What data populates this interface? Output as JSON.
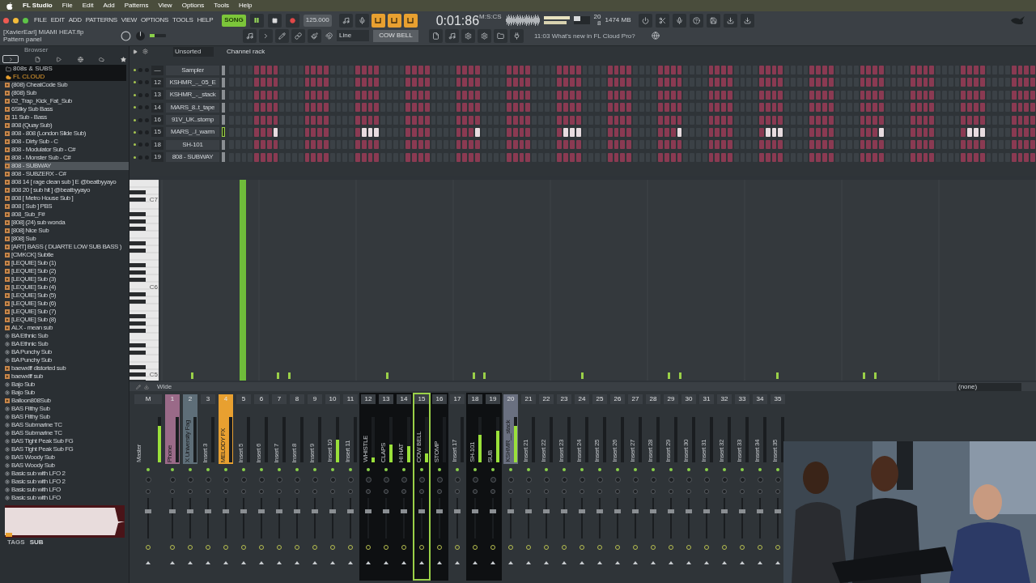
{
  "menubar": {
    "app": "FL Studio",
    "items": [
      "File",
      "Edit",
      "Add",
      "Patterns",
      "View",
      "Options",
      "Tools",
      "Help"
    ]
  },
  "toolbar": {
    "pitch": {
      "level": 0.3
    },
    "menu": [
      "FILE",
      "EDIT",
      "ADD",
      "PATTERNS",
      "VIEW",
      "OPTIONS",
      "TOOLS",
      "HELP"
    ],
    "song_mode": {
      "label": "SONG",
      "on": true
    },
    "tempo": "125.000",
    "toggles": [
      {
        "on": true
      },
      {
        "on": true
      },
      {
        "on": true
      }
    ],
    "time": "0:01:86",
    "time_unit": "M:S:CS",
    "cpu": "20",
    "memory": "1474 MB",
    "polyphony": "8",
    "project": "[XavierEarl] MIAMI HEAT.flp",
    "hint": "Pattern panel",
    "snap": "Line",
    "pattern": "COW BELL",
    "news": "11:03 What's new in FL Cloud Pro?"
  },
  "browser": {
    "title": "Browser",
    "folder": "808s & SUBS",
    "cloud": "FL CLOUD",
    "items": [
      {
        "name": "(808) CheatCode Sub",
        "kind": "audio",
        "selected": false
      },
      {
        "name": "(808) Sub",
        "kind": "audio",
        "selected": false
      },
      {
        "name": "02_Trap_Kick_Fat_Sub",
        "kind": "audio",
        "selected": false
      },
      {
        "name": "6Silky Sub Bass",
        "kind": "audio",
        "selected": false
      },
      {
        "name": "11 Sub - Bass",
        "kind": "audio",
        "selected": false
      },
      {
        "name": "808 (Quay Sub)",
        "kind": "audio",
        "selected": false
      },
      {
        "name": "808 - 808 (London Slide Sub)",
        "kind": "audio",
        "selected": false
      },
      {
        "name": "808 - Dirty Sub - C",
        "kind": "audio",
        "selected": false
      },
      {
        "name": "808 - Modulator Sub - C#",
        "kind": "audio",
        "selected": false
      },
      {
        "name": "808 - Monster Sub - C#",
        "kind": "audio",
        "selected": false
      },
      {
        "name": "808 - SUBWAY",
        "kind": "audio",
        "selected": true
      },
      {
        "name": "808 - SUBZERX - C#",
        "kind": "audio",
        "selected": false
      },
      {
        "name": "808 14 [ rage clean sub ] E @beatbyyayo",
        "kind": "audio",
        "selected": false
      },
      {
        "name": "808 20 [ sub hit ] @beatbyyayo",
        "kind": "audio",
        "selected": false
      },
      {
        "name": "808 [ Metro House Sub ]",
        "kind": "audio",
        "selected": false
      },
      {
        "name": "808 [ Sub ] PBS",
        "kind": "audio",
        "selected": false
      },
      {
        "name": "808_Sub_F#",
        "kind": "audio",
        "selected": false
      },
      {
        "name": "[808] (24) sub wonda",
        "kind": "audio",
        "selected": false
      },
      {
        "name": "[808] Nice Sub",
        "kind": "audio",
        "selected": false
      },
      {
        "name": "[808] Sub",
        "kind": "audio",
        "selected": false
      },
      {
        "name": "[ART] BASS ( DUARTE LOW SUB BASS )",
        "kind": "audio",
        "selected": false
      },
      {
        "name": "[CMKCK] Subtle",
        "kind": "audio",
        "selected": false
      },
      {
        "name": "[LEQUIE] Sub (1)",
        "kind": "audio",
        "selected": false
      },
      {
        "name": "[LEQUIE] Sub (2)",
        "kind": "audio",
        "selected": false
      },
      {
        "name": "[LEQUIE] Sub (3)",
        "kind": "audio",
        "selected": false
      },
      {
        "name": "[LEQUIE] Sub (4)",
        "kind": "audio",
        "selected": false
      },
      {
        "name": "[LEQUIE] Sub (5)",
        "kind": "audio",
        "selected": false
      },
      {
        "name": "[LEQUIE] Sub (6)",
        "kind": "audio",
        "selected": false
      },
      {
        "name": "[LEQUIE] Sub (7)",
        "kind": "audio",
        "selected": false
      },
      {
        "name": "[LEQUIE] Sub (8)",
        "kind": "audio",
        "selected": false
      },
      {
        "name": "ALX - mean sub",
        "kind": "audio",
        "selected": false
      },
      {
        "name": "BA Ethnic Sub",
        "kind": "preset",
        "selected": false
      },
      {
        "name": "BA Ethnic Sub",
        "kind": "preset",
        "selected": false
      },
      {
        "name": "BA Punchy Sub",
        "kind": "preset",
        "selected": false
      },
      {
        "name": "BA Punchy Sub",
        "kind": "preset",
        "selected": false
      },
      {
        "name": "baewxlff distorted sub",
        "kind": "audio",
        "selected": false
      },
      {
        "name": "baewxlff sub",
        "kind": "audio",
        "selected": false
      },
      {
        "name": "Bajo Sub",
        "kind": "preset",
        "selected": false
      },
      {
        "name": "Bajo Sub",
        "kind": "preset",
        "selected": false
      },
      {
        "name": "Balloon808Sub",
        "kind": "audio",
        "selected": false
      },
      {
        "name": "BAS Filthy Sub",
        "kind": "preset",
        "selected": false
      },
      {
        "name": "BAS Filthy Sub",
        "kind": "preset",
        "selected": false
      },
      {
        "name": "BAS Submarine TC",
        "kind": "preset",
        "selected": false
      },
      {
        "name": "BAS Submarine TC",
        "kind": "preset",
        "selected": false
      },
      {
        "name": "BAS Tight Peak Sub FG",
        "kind": "preset",
        "selected": false
      },
      {
        "name": "BAS Tight Peak Sub FG",
        "kind": "preset",
        "selected": false
      },
      {
        "name": "BAS Woody Sub",
        "kind": "preset",
        "selected": false
      },
      {
        "name": "BAS Woody Sub",
        "kind": "preset",
        "selected": false
      },
      {
        "name": "Basic sub with LFO 2",
        "kind": "preset",
        "selected": false
      },
      {
        "name": "Basic sub with LFO 2",
        "kind": "preset",
        "selected": false
      },
      {
        "name": "Basic sub with LFO",
        "kind": "preset",
        "selected": false
      },
      {
        "name": "Basic sub with LFO",
        "kind": "preset",
        "selected": false
      }
    ],
    "tags_label": "TAGS",
    "tag": "SUB"
  },
  "channel_rack": {
    "filter": "Unsorted",
    "title": "Channel rack",
    "channels": [
      {
        "number": "—",
        "name": "Sampler",
        "selected": false,
        "steps": [
          false,
          false,
          false,
          false,
          true,
          true,
          true,
          true,
          false,
          false,
          false,
          false,
          true,
          true,
          true,
          true,
          false,
          false,
          false,
          false,
          true,
          true,
          true,
          true,
          false,
          false,
          false,
          false,
          true,
          true,
          true,
          true
        ],
        "lit": [
          false,
          false,
          false,
          false,
          false,
          false,
          false,
          false,
          false,
          false,
          false,
          false,
          false,
          false,
          false,
          false,
          false,
          false,
          false,
          false,
          false,
          false,
          false,
          false,
          false,
          false,
          false,
          false,
          false,
          false,
          false,
          false
        ]
      },
      {
        "number": "12",
        "name": "KSHMR_.._05_E",
        "selected": false,
        "steps": [
          false,
          false,
          false,
          false,
          true,
          true,
          true,
          true,
          false,
          false,
          false,
          false,
          true,
          true,
          true,
          true,
          false,
          false,
          false,
          false,
          true,
          true,
          true,
          true,
          false,
          false,
          false,
          false,
          true,
          true,
          true,
          true
        ],
        "lit": [
          false,
          false,
          false,
          false,
          false,
          false,
          false,
          false,
          false,
          false,
          false,
          false,
          false,
          false,
          false,
          false,
          false,
          false,
          false,
          false,
          false,
          false,
          false,
          false,
          false,
          false,
          false,
          false,
          false,
          false,
          false,
          false
        ]
      },
      {
        "number": "13",
        "name": "KSHMR_.._stack",
        "selected": false,
        "steps": [
          false,
          false,
          false,
          false,
          true,
          true,
          true,
          true,
          false,
          false,
          false,
          false,
          true,
          true,
          true,
          true,
          false,
          false,
          false,
          false,
          true,
          true,
          true,
          true,
          false,
          false,
          false,
          false,
          true,
          true,
          true,
          true
        ],
        "lit": [
          false,
          false,
          false,
          false,
          false,
          false,
          false,
          false,
          false,
          false,
          false,
          false,
          false,
          false,
          false,
          false,
          false,
          false,
          false,
          false,
          false,
          false,
          false,
          false,
          false,
          false,
          false,
          false,
          false,
          false,
          false,
          false
        ]
      },
      {
        "number": "14",
        "name": "MARS_8..t_tape",
        "selected": false,
        "steps": [
          false,
          false,
          false,
          false,
          true,
          true,
          true,
          true,
          false,
          false,
          false,
          false,
          true,
          true,
          true,
          true,
          false,
          false,
          false,
          false,
          true,
          true,
          true,
          true,
          false,
          false,
          false,
          false,
          true,
          true,
          true,
          true
        ],
        "lit": [
          false,
          false,
          false,
          false,
          false,
          false,
          false,
          false,
          false,
          false,
          false,
          false,
          false,
          false,
          false,
          false,
          false,
          false,
          false,
          false,
          false,
          false,
          false,
          false,
          false,
          false,
          false,
          false,
          false,
          false,
          false,
          false
        ]
      },
      {
        "number": "16",
        "name": "91V_UK..stomp",
        "selected": false,
        "steps": [
          false,
          false,
          false,
          false,
          true,
          true,
          true,
          true,
          false,
          false,
          false,
          false,
          true,
          true,
          true,
          true,
          false,
          false,
          false,
          false,
          true,
          true,
          true,
          true,
          false,
          false,
          false,
          false,
          true,
          true,
          true,
          true
        ],
        "lit": [
          false,
          false,
          false,
          false,
          false,
          false,
          false,
          false,
          false,
          false,
          false,
          false,
          false,
          false,
          false,
          false,
          false,
          false,
          false,
          false,
          false,
          false,
          false,
          false,
          false,
          false,
          false,
          false,
          false,
          false,
          false,
          false
        ]
      },
      {
        "number": "15",
        "name": "MARS_..l_warm",
        "selected": true,
        "steps": [
          false,
          false,
          false,
          false,
          true,
          true,
          true,
          true,
          false,
          false,
          false,
          false,
          true,
          true,
          true,
          true,
          false,
          false,
          false,
          false,
          true,
          true,
          true,
          true,
          false,
          false,
          false,
          false,
          true,
          true,
          true,
          true
        ],
        "lit": [
          false,
          false,
          false,
          false,
          false,
          false,
          false,
          true,
          false,
          false,
          false,
          false,
          false,
          false,
          false,
          false,
          false,
          false,
          false,
          false,
          false,
          true,
          true,
          true,
          false,
          false,
          false,
          false,
          false,
          false,
          false,
          false
        ]
      },
      {
        "number": "18",
        "name": "SH-101",
        "selected": false,
        "steps": [
          false,
          false,
          false,
          false,
          true,
          true,
          true,
          true,
          false,
          false,
          false,
          false,
          true,
          true,
          true,
          true,
          false,
          false,
          false,
          false,
          true,
          true,
          true,
          true,
          false,
          false,
          false,
          false,
          true,
          true,
          true,
          true
        ],
        "lit": [
          false,
          false,
          false,
          false,
          false,
          false,
          false,
          false,
          false,
          false,
          false,
          false,
          false,
          false,
          false,
          false,
          false,
          false,
          false,
          false,
          false,
          false,
          false,
          false,
          false,
          false,
          false,
          false,
          false,
          false,
          false,
          false
        ]
      },
      {
        "number": "19",
        "name": "808 - SUBWAY",
        "selected": false,
        "steps": [
          false,
          false,
          false,
          false,
          true,
          true,
          true,
          true,
          false,
          false,
          false,
          false,
          true,
          true,
          true,
          true,
          false,
          false,
          false,
          false,
          true,
          true,
          true,
          true,
          false,
          false,
          false,
          false,
          true,
          true,
          true,
          true
        ],
        "lit": [
          false,
          false,
          false,
          false,
          false,
          false,
          false,
          false,
          false,
          false,
          false,
          false,
          false,
          false,
          false,
          false,
          false,
          false,
          false,
          false,
          false,
          false,
          false,
          false,
          false,
          false,
          false,
          false,
          false,
          false,
          false,
          false
        ]
      }
    ]
  },
  "piano_roll": {
    "key_labels": [
      "C7",
      "C6",
      "C5"
    ]
  },
  "mixer": {
    "mode": "Wide",
    "route": "(none)",
    "tracks": [
      {
        "number": "M",
        "name": "Master",
        "color": "#3a3f44",
        "level": 0.8,
        "highlighted": false,
        "selected": false
      },
      {
        "number": "1",
        "name": "Phone",
        "color": "#9a6a88",
        "level": 0,
        "highlighted": false,
        "selected": false
      },
      {
        "number": "2",
        "name": "X University Fag",
        "color": "#5e6e78",
        "level": 0,
        "highlighted": false,
        "selected": false
      },
      {
        "number": "3",
        "name": "Insert 3",
        "color": "#3a3f44",
        "level": 0,
        "highlighted": false,
        "selected": false
      },
      {
        "number": "4",
        "name": "MELODY FX",
        "color": "#e8a030",
        "level": 0,
        "highlighted": false,
        "selected": false
      },
      {
        "number": "5",
        "name": "Insert 5",
        "color": "#3a3f44",
        "level": 0,
        "highlighted": false,
        "selected": false
      },
      {
        "number": "6",
        "name": "Insert 6",
        "color": "#3a3f44",
        "level": 0,
        "highlighted": false,
        "selected": false
      },
      {
        "number": "7",
        "name": "Insert 7",
        "color": "#3a3f44",
        "level": 0,
        "highlighted": false,
        "selected": false
      },
      {
        "number": "8",
        "name": "Insert 8",
        "color": "#3a3f44",
        "level": 0,
        "highlighted": false,
        "selected": false
      },
      {
        "number": "9",
        "name": "Insert 9",
        "color": "#3a3f44",
        "level": 0,
        "highlighted": false,
        "selected": false
      },
      {
        "number": "10",
        "name": "Insert 10",
        "color": "#3a3f44",
        "level": 0.5,
        "highlighted": false,
        "selected": false
      },
      {
        "number": "11",
        "name": "Insert 11",
        "color": "#3a3f44",
        "level": 0,
        "highlighted": false,
        "selected": false
      },
      {
        "number": "12",
        "name": "WHISTLE",
        "color": "#3a3f44",
        "level": 0.1,
        "highlighted": true,
        "selected": false
      },
      {
        "number": "13",
        "name": "CLAPS",
        "color": "#3a3f44",
        "level": 0.4,
        "highlighted": true,
        "selected": false
      },
      {
        "number": "14",
        "name": "HI HAT",
        "color": "#3a3f44",
        "level": 0.35,
        "highlighted": true,
        "selected": false
      },
      {
        "number": "15",
        "name": "COW BELL",
        "color": "#3a3f44",
        "level": 0.2,
        "highlighted": true,
        "selected": true
      },
      {
        "number": "16",
        "name": "STOMP",
        "color": "#3a3f44",
        "level": 0,
        "highlighted": true,
        "selected": false
      },
      {
        "number": "17",
        "name": "Insert 17",
        "color": "#3a3f44",
        "level": 0,
        "highlighted": false,
        "selected": false
      },
      {
        "number": "18",
        "name": "SH-101",
        "color": "#3a3f44",
        "level": 0.6,
        "highlighted": true,
        "selected": false
      },
      {
        "number": "19",
        "name": "SUB",
        "color": "#3a3f44",
        "level": 0.7,
        "highlighted": true,
        "selected": false
      },
      {
        "number": "20",
        "name": "KSHMR__stack",
        "color": "#6a7080",
        "level": 0.8,
        "highlighted": false,
        "selected": false
      },
      {
        "number": "21",
        "name": "Insert 21",
        "color": "#3a3f44",
        "level": 0,
        "highlighted": false,
        "selected": false
      },
      {
        "number": "22",
        "name": "Insert 22",
        "color": "#3a3f44",
        "level": 0,
        "highlighted": false,
        "selected": false
      },
      {
        "number": "23",
        "name": "Insert 23",
        "color": "#3a3f44",
        "level": 0,
        "highlighted": false,
        "selected": false
      },
      {
        "number": "24",
        "name": "Insert 24",
        "color": "#3a3f44",
        "level": 0,
        "highlighted": false,
        "selected": false
      },
      {
        "number": "25",
        "name": "Insert 25",
        "color": "#3a3f44",
        "level": 0,
        "highlighted": false,
        "selected": false
      },
      {
        "number": "26",
        "name": "Insert 26",
        "color": "#3a3f44",
        "level": 0,
        "highlighted": false,
        "selected": false
      },
      {
        "number": "27",
        "name": "Insert 27",
        "color": "#3a3f44",
        "level": 0,
        "highlighted": false,
        "selected": false
      },
      {
        "number": "28",
        "name": "Insert 28",
        "color": "#3a3f44",
        "level": 0,
        "highlighted": false,
        "selected": false
      },
      {
        "number": "29",
        "name": "Insert 29",
        "color": "#3a3f44",
        "level": 0,
        "highlighted": false,
        "selected": false
      },
      {
        "number": "30",
        "name": "Insert 30",
        "color": "#3a3f44",
        "level": 0,
        "highlighted": false,
        "selected": false
      },
      {
        "number": "31",
        "name": "Insert 31",
        "color": "#3a3f44",
        "level": 0,
        "highlighted": false,
        "selected": false
      },
      {
        "number": "32",
        "name": "Insert 32",
        "color": "#3a3f44",
        "level": 0,
        "highlighted": false,
        "selected": false
      },
      {
        "number": "33",
        "name": "Insert 33",
        "color": "#3a3f44",
        "level": 0,
        "highlighted": false,
        "selected": false
      },
      {
        "number": "34",
        "name": "Insert 34",
        "color": "#3a3f44",
        "level": 0,
        "highlighted": false,
        "selected": false
      },
      {
        "number": "35",
        "name": "Insert 35",
        "color": "#3a3f44",
        "level": 0,
        "highlighted": false,
        "selected": false
      }
    ]
  }
}
